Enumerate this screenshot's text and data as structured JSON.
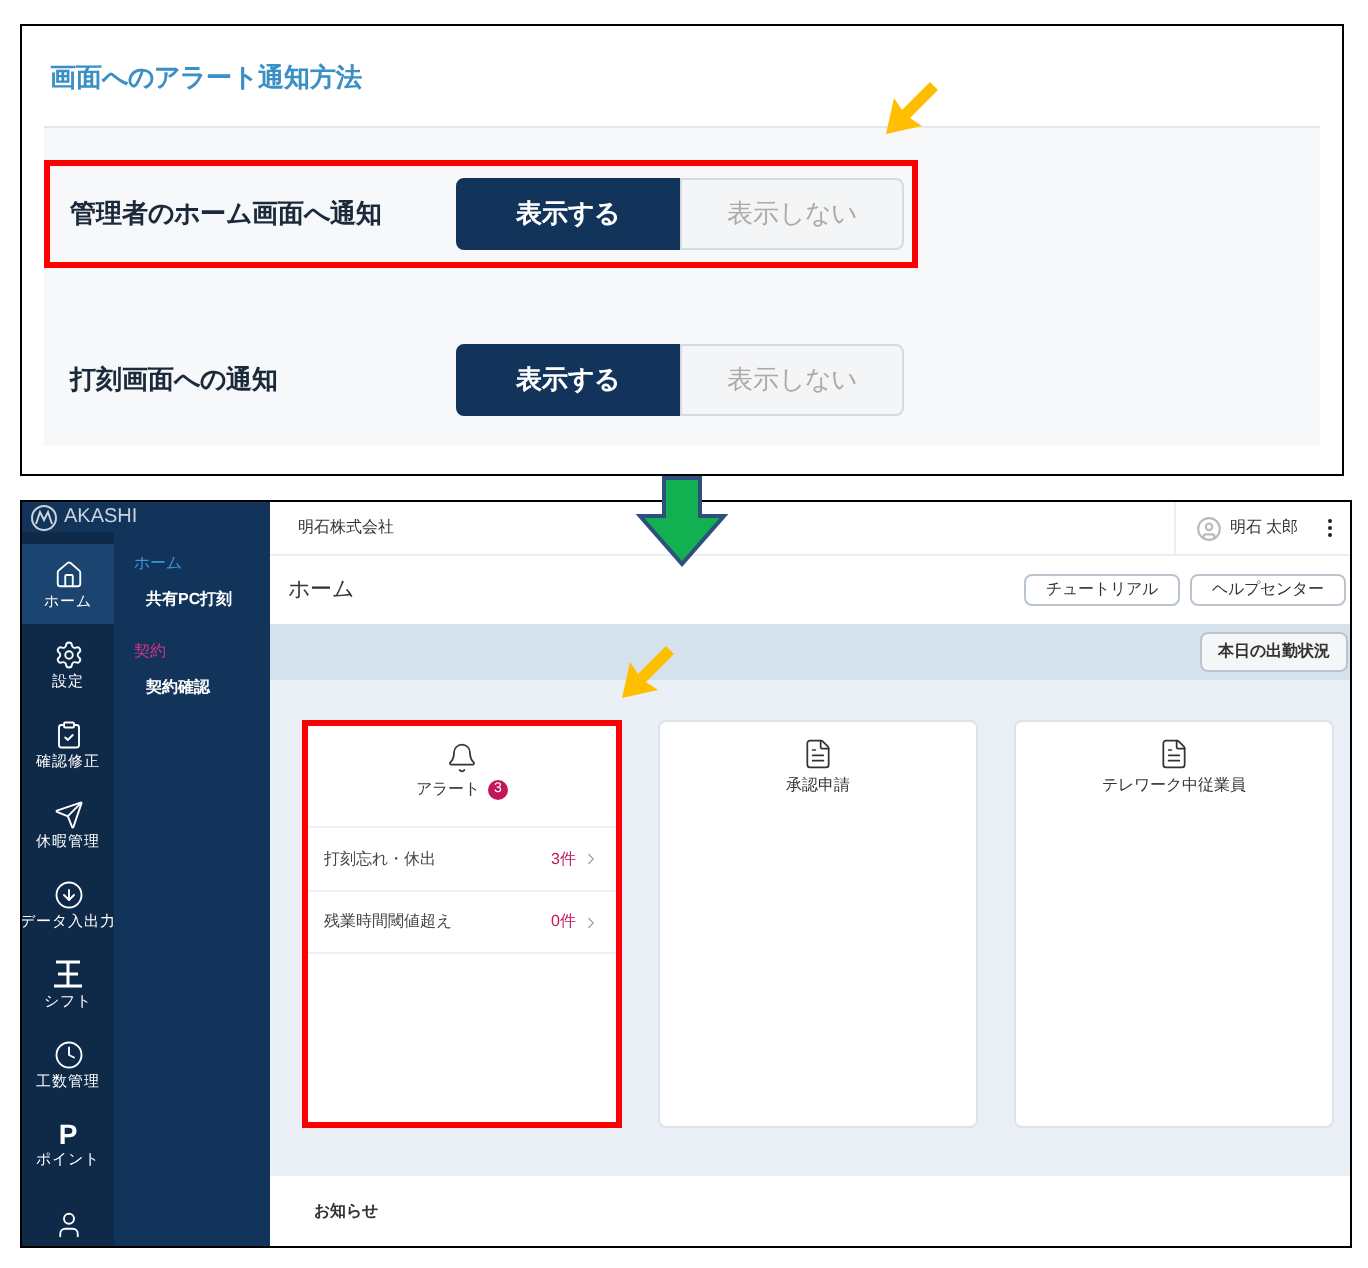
{
  "settings_panel": {
    "title": "画面へのアラート通知方法",
    "settings": [
      {
        "label": "管理者のホーム画面へ通知",
        "highlighted": true,
        "options": [
          {
            "label": "表示する",
            "selected": true
          },
          {
            "label": "表示しない",
            "selected": false
          }
        ]
      },
      {
        "label": "打刻画面への通知",
        "highlighted": false,
        "options": [
          {
            "label": "表示する",
            "selected": true
          },
          {
            "label": "表示しない",
            "selected": false
          }
        ]
      }
    ]
  },
  "app": {
    "logo": "AKASHI",
    "rail": [
      {
        "label": "ホーム",
        "selected": true
      },
      {
        "label": "設定",
        "selected": false
      },
      {
        "label": "確認修正",
        "selected": false
      },
      {
        "label": "休暇管理",
        "selected": false
      },
      {
        "label": "データ入出力",
        "selected": false
      },
      {
        "label": "シフト",
        "selected": false
      },
      {
        "label": "工数管理",
        "selected": false
      },
      {
        "label": "ポイント",
        "glyph": "P",
        "selected": false
      },
      {
        "selected": false
      }
    ],
    "submenu": [
      {
        "heading": "ホーム",
        "color": "#3b9ad9",
        "items": [
          "共有PC打刻"
        ]
      },
      {
        "heading": "契約",
        "color": "#d6338a",
        "items": [
          "契約確認"
        ]
      }
    ],
    "company": "明石株式会社",
    "user": "明石 太郎",
    "page_title": "ホーム",
    "header_buttons": [
      "チュートリアル",
      "ヘルプセンター"
    ],
    "status_button": "本日の出勤状況",
    "cards": [
      {
        "kind": "alert",
        "title": "アラート",
        "badge": "3",
        "highlighted": true,
        "rows": [
          {
            "label": "打刻忘れ・休出",
            "count": "3件"
          },
          {
            "label": "残業時間閾値超え",
            "count": "0件"
          }
        ]
      },
      {
        "kind": "document",
        "title": "承認申請",
        "highlighted": false
      },
      {
        "kind": "document",
        "title": "テレワーク中従業員",
        "highlighted": false
      }
    ],
    "notice_title": "お知らせ"
  }
}
